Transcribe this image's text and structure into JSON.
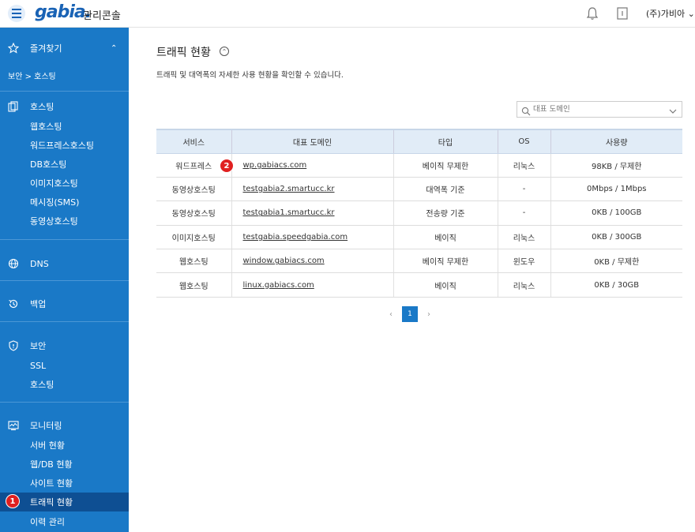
{
  "header": {
    "logo": "gabia.",
    "console_title": "관리콘솔",
    "user": "(주)가비아"
  },
  "sidebar": {
    "favorites": "즐겨찾기",
    "breadcrumb": "보안 > 호스팅",
    "sections": [
      {
        "label": "호스팅",
        "icon": "hosting-icon",
        "children": [
          "웹호스팅",
          "워드프레스호스팅",
          "DB호스팅",
          "이미지호스팅",
          "메시징(SMS)",
          "동영상호스팅"
        ]
      },
      {
        "label": "DNS",
        "icon": "globe-icon",
        "children": []
      },
      {
        "label": "백업",
        "icon": "backup-icon",
        "children": []
      },
      {
        "label": "보안",
        "icon": "shield-icon",
        "children": [
          "SSL",
          "호스팅"
        ]
      },
      {
        "label": "모니터링",
        "icon": "monitor-icon",
        "children": [
          "서버 현황",
          "웹/DB 현황",
          "사이트 현황",
          "트래픽 현황",
          "이력 관리"
        ]
      }
    ],
    "active_item": "트래픽 현황"
  },
  "main": {
    "title": "트래픽 현황",
    "description": "트래픽 및 대역폭의 자세한 사용 현황을 확인할 수 있습니다.",
    "search_placeholder": "대표 도메인",
    "columns": [
      "서비스",
      "대표 도메인",
      "타입",
      "OS",
      "사용량"
    ],
    "rows": [
      {
        "service": "워드프레스",
        "domain": "wp.gabiacs.com",
        "type": "베이직 무제한",
        "os": "리눅스",
        "usage": "98KB / 무제한"
      },
      {
        "service": "동영상호스팅",
        "domain": "testgabia2.smartucc.kr",
        "type": "대역폭 기준",
        "os": "-",
        "usage": "0Mbps / 1Mbps"
      },
      {
        "service": "동영상호스팅",
        "domain": "testgabia1.smartucc.kr",
        "type": "전송량 기준",
        "os": "-",
        "usage": "0KB / 100GB"
      },
      {
        "service": "이미지호스팅",
        "domain": "testgabia.speedgabia.com",
        "type": "베이직",
        "os": "리눅스",
        "usage": "0KB / 300GB"
      },
      {
        "service": "웹호스팅",
        "domain": "window.gabiacs.com",
        "type": "베이직 무제한",
        "os": "윈도우",
        "usage": "0KB / 무제한"
      },
      {
        "service": "웹호스팅",
        "domain": "linux.gabiacs.com",
        "type": "베이직",
        "os": "리눅스",
        "usage": "0KB / 30GB"
      }
    ],
    "pagination": {
      "prev": "‹",
      "current": "1",
      "next": "›"
    }
  },
  "badges": {
    "one": "1",
    "two": "2"
  },
  "colors": {
    "sidebar": "#1a79c7",
    "active": "#0e4f93",
    "brand": "#1a63b5",
    "badge": "#e02020"
  }
}
